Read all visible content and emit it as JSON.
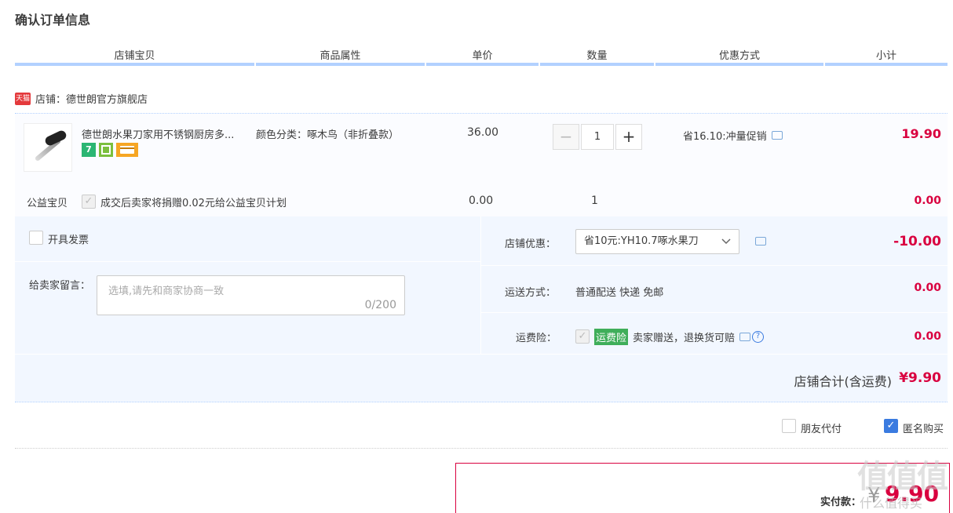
{
  "page_title": "确认订单信息",
  "columns": [
    "店铺宝贝",
    "商品属性",
    "单价",
    "数量",
    "优惠方式",
    "小计"
  ],
  "shop": {
    "badge": "天猫",
    "label": "店铺：德世朗官方旗舰店"
  },
  "item": {
    "name": "德世朗水果刀家用不锈钢厨房多...",
    "attr": "颜色分类：啄木鸟（非折叠款）",
    "price": "36.00",
    "qty": "1",
    "promo": "省16.10:冲量促销",
    "subtotal": "19.90",
    "icon_7": "7"
  },
  "charity": {
    "label": "公益宝贝",
    "text": "成交后卖家将捐赠0.02元给公益宝贝计划",
    "price": "0.00",
    "qty": "1",
    "subtotal": "0.00"
  },
  "invoice": {
    "label": "开具发票"
  },
  "message": {
    "label": "给卖家留言：",
    "placeholder": "选填,请先和商家协商一致",
    "count": "0/200"
  },
  "shop_discount": {
    "label": "店铺优惠：",
    "value": "省10元:YH10.7啄水果刀",
    "amount": "-10.00"
  },
  "shipping": {
    "label": "运送方式：",
    "value": "普通配送 快递 免邮",
    "amount": "0.00"
  },
  "insurance": {
    "label": "运费险：",
    "tag": "运费险",
    "text": "卖家赠送，退换货可赔",
    "amount": "0.00"
  },
  "shop_total": {
    "label": "店铺合计(含运费)",
    "amount": "¥9.90"
  },
  "options": {
    "friend_pay": "朋友代付",
    "anonymous": "匿名购买"
  },
  "pay": {
    "label": "实付款：",
    "amount": "9.90",
    "currency": "¥"
  },
  "watermark": {
    "main": "值值值",
    "sub": "什么值得买"
  }
}
